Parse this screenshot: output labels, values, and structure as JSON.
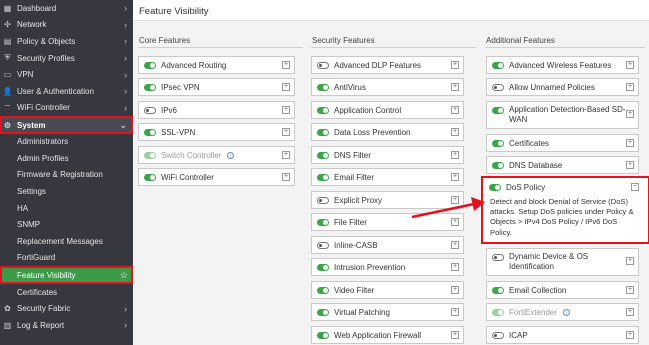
{
  "sidebar": {
    "items": [
      {
        "label": "Dashboard",
        "icon": "dashboard-icon",
        "glyph": "▦"
      },
      {
        "label": "Network",
        "icon": "network-icon",
        "glyph": "✣"
      },
      {
        "label": "Policy & Objects",
        "icon": "policy-icon",
        "glyph": "▤"
      },
      {
        "label": "Security Profiles",
        "icon": "shield-icon",
        "glyph": "⛨"
      },
      {
        "label": "VPN",
        "icon": "monitor-icon",
        "glyph": "▭"
      },
      {
        "label": "User & Authentication",
        "icon": "user-icon",
        "glyph": "👤"
      },
      {
        "label": "WiFi Controller",
        "icon": "wifi-icon",
        "glyph": "⌔"
      },
      {
        "label": "System",
        "icon": "gear-icon",
        "glyph": "⚙"
      }
    ],
    "system_sub": [
      "Administrators",
      "Admin Profiles",
      "Firmware & Registration",
      "Settings",
      "HA",
      "SNMP",
      "Replacement Messages",
      "FortiGuard",
      "Feature Visibility",
      "Certificates"
    ],
    "bottom_items": [
      {
        "label": "Security Fabric",
        "icon": "fabric-icon",
        "glyph": "✿"
      },
      {
        "label": "Log & Report",
        "icon": "report-icon",
        "glyph": "▥"
      }
    ]
  },
  "page": {
    "title": "Feature Visibility"
  },
  "columns": {
    "core": {
      "header": "Core Features",
      "items": [
        {
          "label": "Advanced Routing",
          "state": "on"
        },
        {
          "label": "IPsec VPN",
          "state": "on"
        },
        {
          "label": "IPv6",
          "state": "off"
        },
        {
          "label": "SSL-VPN",
          "state": "on"
        },
        {
          "label": "Switch Controller",
          "state": "disabled"
        },
        {
          "label": "WiFi Controller",
          "state": "on"
        }
      ]
    },
    "security": {
      "header": "Security Features",
      "items": [
        {
          "label": "Advanced DLP Features",
          "state": "off"
        },
        {
          "label": "AntiVirus",
          "state": "on"
        },
        {
          "label": "Application Control",
          "state": "on"
        },
        {
          "label": "Data Loss Prevention",
          "state": "on"
        },
        {
          "label": "DNS Filter",
          "state": "on"
        },
        {
          "label": "Email Filter",
          "state": "on"
        },
        {
          "label": "Explicit Proxy",
          "state": "off"
        },
        {
          "label": "File Filter",
          "state": "on"
        },
        {
          "label": "Inline-CASB",
          "state": "off"
        },
        {
          "label": "Intrusion Prevention",
          "state": "on"
        },
        {
          "label": "Video Filter",
          "state": "on"
        },
        {
          "label": "Virtual Patching",
          "state": "on"
        },
        {
          "label": "Web Application Firewall",
          "state": "on"
        }
      ]
    },
    "additional": {
      "header": "Additional Features",
      "items": [
        {
          "label": "Advanced Wireless Features",
          "state": "on"
        },
        {
          "label": "Allow Unnamed Policies",
          "state": "off"
        },
        {
          "label": "Application Detection-Based SD-WAN",
          "state": "on"
        },
        {
          "label": "Certificates",
          "state": "on"
        },
        {
          "label": "DNS Database",
          "state": "on"
        },
        {
          "label": "DoS Policy",
          "state": "on"
        },
        {
          "label": "Dynamic Device & OS Identification",
          "state": "off"
        },
        {
          "label": "Email Collection",
          "state": "on"
        },
        {
          "label": "FortiExtender",
          "state": "disabled"
        },
        {
          "label": "ICAP",
          "state": "off"
        }
      ],
      "dos_description": "Detect and block Denial of Service (DoS) attacks. Setup DoS policies under Policy & Objects > IPv4 DoS Policy / IPv6 DoS Policy."
    }
  },
  "colors": {
    "sidebar_bg": "#37373f",
    "accent_green": "#3aa648",
    "highlight_red": "#e0141e",
    "selected_green": "#3d9a46"
  }
}
